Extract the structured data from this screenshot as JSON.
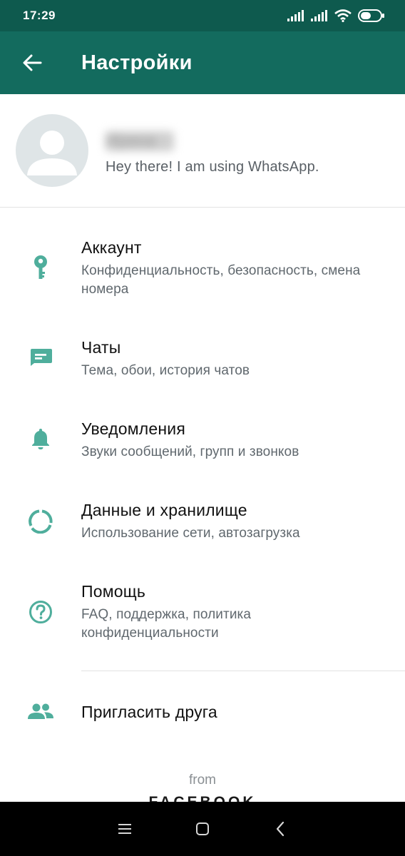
{
  "status_bar": {
    "time": "17:29"
  },
  "app_bar": {
    "title": "Настройки",
    "back_icon": "arrow-left-icon"
  },
  "profile": {
    "name": "Ирина",
    "status": "Hey there! I am using WhatsApp."
  },
  "settings": [
    {
      "icon": "key-icon",
      "title": "Аккаунт",
      "subtitle": "Конфиденциальность, безопасность, смена номера"
    },
    {
      "icon": "chat-icon",
      "title": "Чаты",
      "subtitle": "Тема, обои, история чатов"
    },
    {
      "icon": "bell-icon",
      "title": "Уведомления",
      "subtitle": "Звуки сообщений, групп и звонков"
    },
    {
      "icon": "data-usage-icon",
      "title": "Данные и хранилище",
      "subtitle": "Использование сети, автозагрузка"
    },
    {
      "icon": "help-icon",
      "title": "Помощь",
      "subtitle": "FAQ, поддержка, политика конфиденциальности"
    }
  ],
  "invite": {
    "icon": "people-icon",
    "title": "Пригласить друга"
  },
  "footer": {
    "from": "from",
    "brand": "FACEBOOK"
  },
  "colors": {
    "status_bar": "#0e5a4e",
    "app_bar": "#136b5e",
    "icon_accent": "#4fae9c"
  },
  "nav_bar": {
    "menu_icon": "menu-icon",
    "home_icon": "square-icon",
    "back_icon": "chevron-left-icon"
  }
}
